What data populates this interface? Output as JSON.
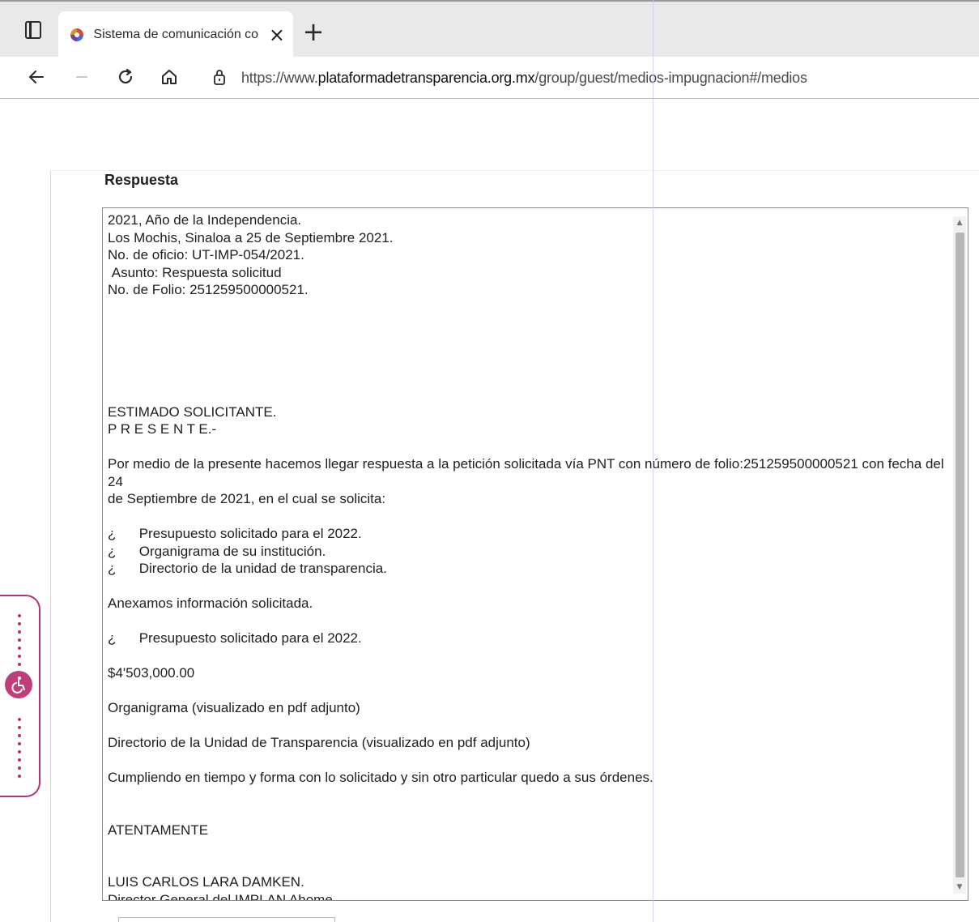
{
  "browser": {
    "tab": {
      "title": "Sistema de comunicación con lo",
      "close_label": "×"
    },
    "new_tab_label": "+",
    "url": {
      "scheme": "https://www.",
      "host": "plataformadetransparencia.org.mx",
      "path": "/group/guest/medios-impugnacion#/medios"
    }
  },
  "section": {
    "label": "Respuesta"
  },
  "response": {
    "lines": [
      "2021, Año de la Independencia.",
      "Los Mochis, Sinaloa a 25 de Septiembre 2021.",
      "No. de oficio: UT-IMP-054/2021.",
      " Asunto: Respuesta solicitud",
      "No. de Folio: 251259500000521.",
      "",
      "",
      "",
      "",
      "",
      "",
      "ESTIMADO SOLICITANTE.",
      "P R E S E N T E.-",
      "",
      "Por medio de la presente hacemos llegar respuesta a la petición solicitada vía PNT con número de folio:251259500000521 con fecha del 24",
      "de Septiembre de 2021, en el cual se solicita:",
      "",
      "¿      Presupuesto solicitado para el 2022.",
      "¿      Organigrama de su institución.",
      "¿      Directorio de la unidad de transparencia.",
      "",
      "Anexamos información solicitada.",
      "",
      "¿      Presupuesto solicitado para el 2022.",
      "",
      "$4'503,000.00",
      "",
      "Organigrama (visualizado en pdf adjunto)",
      "",
      "Directorio de la Unidad de Transparencia (visualizado en pdf adjunto)",
      "",
      "Cumpliendo en tiempo y forma con lo solicitado y sin otro particular quedo a sus órdenes.",
      "",
      "",
      "ATENTAMENTE",
      "",
      "",
      "LUIS CARLOS LARA DAMKEN.",
      "Director General del IMPLAN Ahome."
    ]
  },
  "colors": {
    "accent": "#c13d78",
    "scrollbar_thumb": "#b7b7b7"
  }
}
